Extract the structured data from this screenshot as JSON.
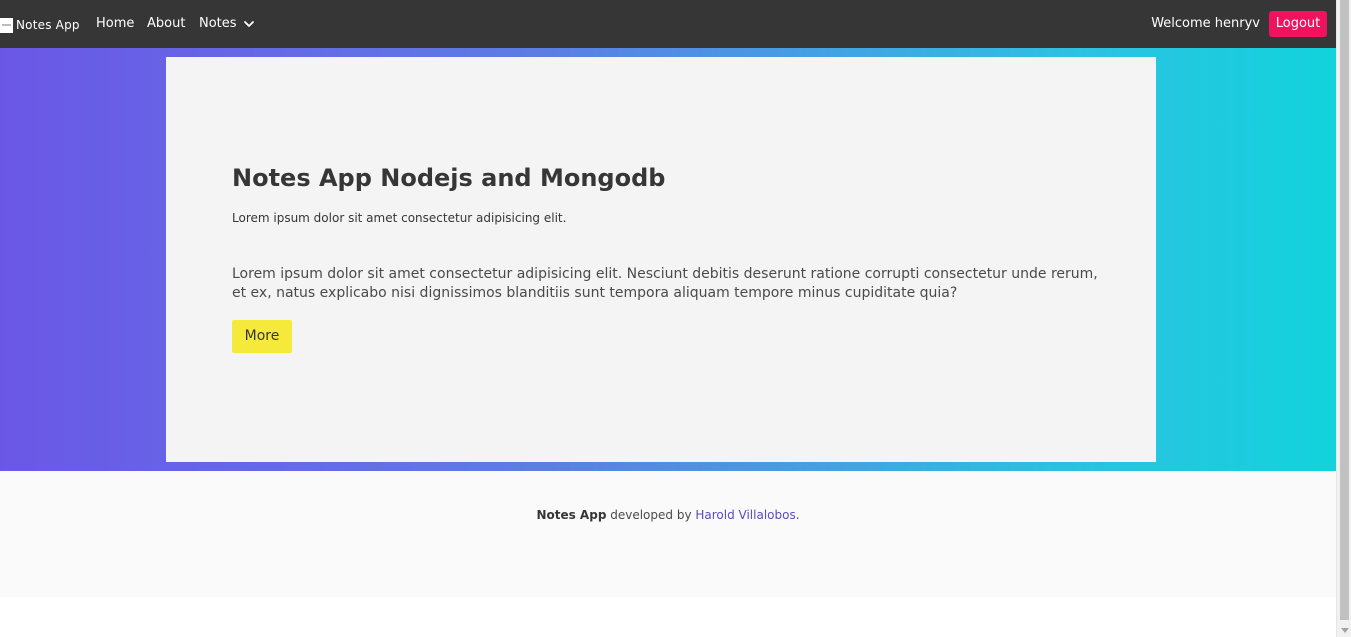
{
  "navbar": {
    "brand": "Notes App",
    "links": {
      "home": "Home",
      "about": "About",
      "notes": "Notes"
    },
    "welcome": "Welcome henryv",
    "logout": "Logout"
  },
  "hero": {
    "title": "Notes App Nodejs and Mongodb",
    "subtitle": "Lorem ipsum dolor sit amet consectetur adipisicing elit.",
    "body": "Lorem ipsum dolor sit amet consectetur adipisicing elit. Nesciunt debitis deserunt ratione corrupti consectetur unde rerum, et ex, natus explicabo nisi dignissimos blanditiis sunt tempora aliquam tempore minus cupiditate quia?",
    "button": "More"
  },
  "footer": {
    "app_name": "Notes App",
    "developed_by": "developed by",
    "author": "Harold Villalobos",
    "period": "."
  },
  "colors": {
    "navbar_bg": "#363636",
    "logout_bg": "#f0125f",
    "more_button_bg": "#f5ea3b",
    "gradient_start": "#6b57e6",
    "gradient_end": "#12d3dc",
    "card_bg": "#f4f4f4",
    "footer_bg": "#fafafa",
    "author_link": "#5a4cc4"
  },
  "icons": {
    "brand": "notes-logo-icon",
    "notes_dropdown": "chevron-down-icon"
  }
}
